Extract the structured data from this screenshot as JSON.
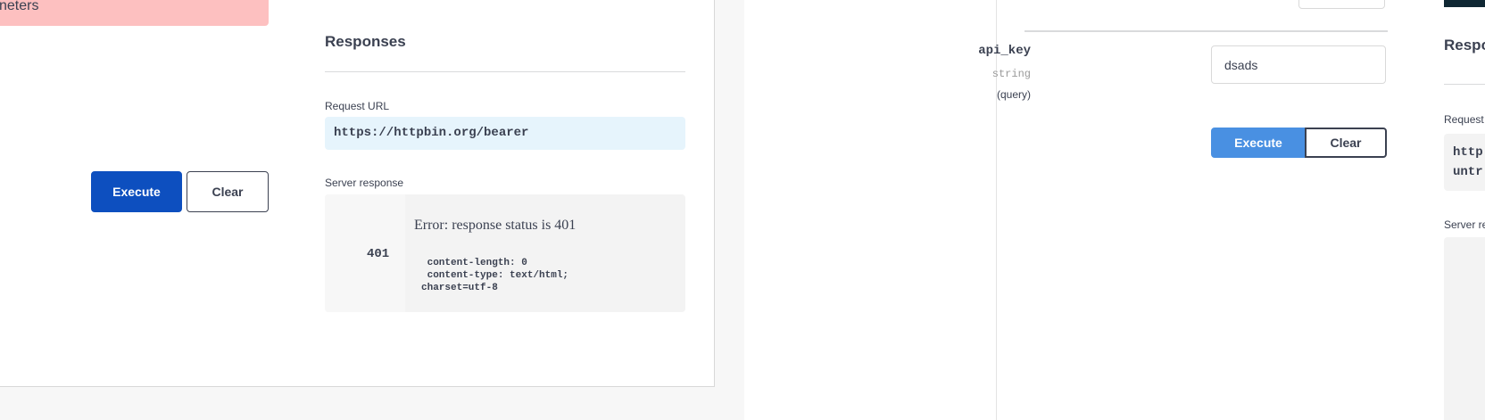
{
  "left": {
    "error_banner_text": "neters",
    "responses_title": "Responses",
    "request_url_label": "Request URL",
    "request_url": "https://httpbin.org/bearer",
    "server_response_label": "Server response",
    "status_code": "401",
    "error_message": "Error: response status is 401",
    "response_headers": " content-length: 0\n content-type: text/html;\ncharset=utf-8",
    "execute_label": "Execute",
    "clear_label": "Clear"
  },
  "right": {
    "param_name": "api_key",
    "param_type": "string",
    "param_in": "(query)",
    "param_value": "dsads",
    "execute_label": "Execute",
    "clear_label": "Clear",
    "responses_title": "Respo",
    "request_url_label": "Request",
    "request_url_partial": "http\nuntr",
    "server_response_label": "Server re"
  },
  "colors": {
    "execute_primary": "#0d4fbf",
    "execute_light": "#4990e2",
    "error_banner": "#fdc0c0",
    "url_box": "#e6f4fc"
  }
}
